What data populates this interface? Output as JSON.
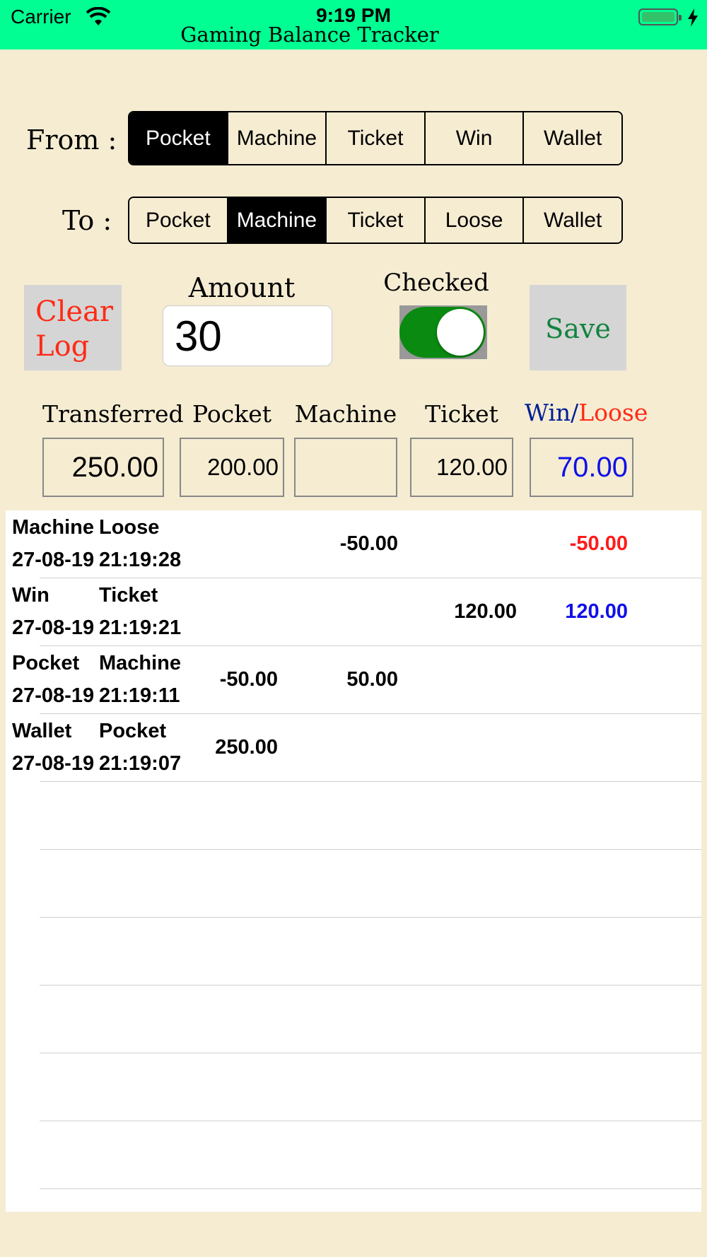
{
  "status": {
    "carrier": "Carrier",
    "time": "9:19 PM",
    "app_title": "Gaming Balance Tracker"
  },
  "from": {
    "label": "From :",
    "options": [
      "Pocket",
      "Machine",
      "Ticket",
      "Win",
      "Wallet"
    ],
    "selected": "Pocket"
  },
  "to": {
    "label": "To :",
    "options": [
      "Pocket",
      "Machine",
      "Ticket",
      "Loose",
      "Wallet"
    ],
    "selected": "Machine"
  },
  "clear_button": {
    "label": "Clear Log",
    "color": "#ff2a16"
  },
  "amount": {
    "label": "Amount",
    "value": "30"
  },
  "checked": {
    "label": "Checked",
    "on": true,
    "color": "#0a8a10"
  },
  "save_button": {
    "label": "Save",
    "color": "#128340"
  },
  "totals": {
    "headers": {
      "transferred": "Transferred",
      "pocket": "Pocket",
      "machine": "Machine",
      "ticket": "Ticket",
      "win": "Win/",
      "loose": "Loose"
    },
    "transferred": "250.00",
    "pocket": "200.00",
    "machine": "",
    "ticket": "120.00",
    "win_loose": "70.00",
    "win_color": "#001e96",
    "loose_color": "#ff2a16",
    "value_color": "#1010e8"
  },
  "log": [
    {
      "from": "Machine",
      "to": "Loose",
      "date": "27-08-19",
      "time": "21:19:28",
      "pocket": "",
      "machine": "-50.00",
      "ticket": "",
      "winloose": "-50.00",
      "winloose_color": "#ff1a1a"
    },
    {
      "from": "Win",
      "to": "Ticket",
      "date": "27-08-19",
      "time": "21:19:21",
      "pocket": "",
      "machine": "",
      "ticket": "120.00",
      "winloose": "120.00",
      "winloose_color": "#1010e8"
    },
    {
      "from": "Pocket",
      "to": "Machine",
      "date": "27-08-19",
      "time": "21:19:11",
      "pocket": "-50.00",
      "machine": "50.00",
      "ticket": "",
      "winloose": "",
      "winloose_color": "#000000"
    },
    {
      "from": "Wallet",
      "to": "Pocket",
      "date": "27-08-19",
      "time": "21:19:07",
      "pocket": "250.00",
      "machine": "",
      "ticket": "",
      "winloose": "",
      "winloose_color": "#000000"
    }
  ]
}
